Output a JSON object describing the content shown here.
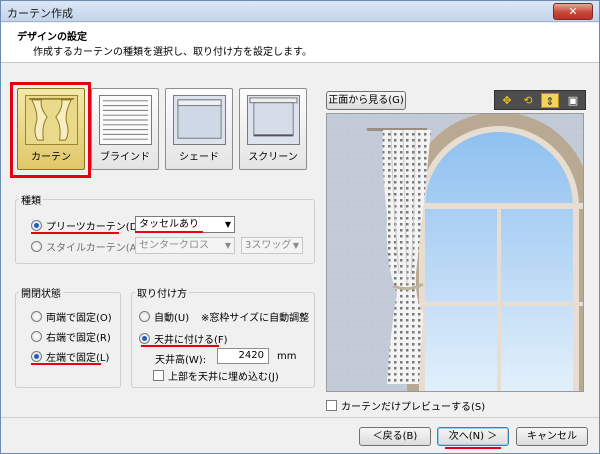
{
  "window": {
    "title": "カーテン作成",
    "close_label": "✕"
  },
  "header": {
    "title": "デザインの設定",
    "description": "作成するカーテンの種類を選択し、取り付け方を設定します。"
  },
  "types": [
    {
      "label": "カーテン",
      "selected": true
    },
    {
      "label": "ブラインド",
      "selected": false
    },
    {
      "label": "シェード",
      "selected": false
    },
    {
      "label": "スクリーン",
      "selected": false
    }
  ],
  "kind_group": {
    "title": "種類",
    "pleats_label": "プリーツカーテン(D)",
    "pleats_value": "タッセルあり",
    "style_label": "スタイルカーテン(A)",
    "style_value1": "センタークロス",
    "style_value2": "3スワッグ"
  },
  "open_group": {
    "title": "開閉状態",
    "options": [
      "両端で固定(O)",
      "右端で固定(R)",
      "左端で固定(L)"
    ],
    "selected": 2
  },
  "mount_group": {
    "title": "取り付け方",
    "auto_label": "自動(U)",
    "auto_note": "※窓枠サイズに自動調整",
    "ceiling_label": "天井に付ける(F)",
    "height_label": "天井高(W):",
    "height_value": "2420",
    "height_unit": "mm",
    "embed_label": "上部を天井に埋め込む(J)"
  },
  "preview": {
    "front_button": "正面から見る(G)",
    "only_curtain_label": "カーテンだけプレビューする(S)",
    "toolbar_icons": [
      "move-icon",
      "rotate-icon",
      "updown-icon",
      "fit-icon"
    ]
  },
  "footer": {
    "back": "＜戻る(B)",
    "next": "次へ(N) ＞",
    "cancel": "キャンセル"
  },
  "colors": {
    "accent_red": "#e60012",
    "selected_yellow": "#e0c869"
  }
}
